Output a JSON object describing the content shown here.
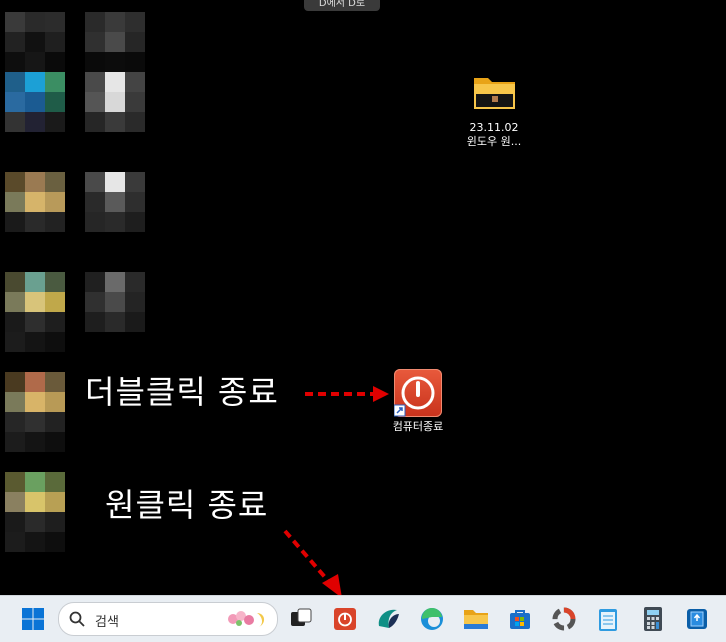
{
  "top_bar": {
    "label": "D에서 D로"
  },
  "desktop": {
    "folder": {
      "label_line1": "23.11.02",
      "label_line2": "윈도우 원..."
    },
    "shortcut": {
      "label": "컴퓨터종료"
    }
  },
  "annotations": {
    "double_click": "더블클릭 종료",
    "single_click": "원클릭 종료"
  },
  "taskbar": {
    "search_placeholder": "검색",
    "items": [
      "start-icon",
      "task-view-icon",
      "shutdown-icon",
      "app-icon",
      "edge-icon",
      "file-explorer-icon",
      "store-icon",
      "settings-app-icon",
      "notepad-icon",
      "calculator-icon",
      "app-icon-blue"
    ]
  },
  "colors": {
    "accent_red": "#e00000",
    "shortcut_red": "#d9442a"
  }
}
